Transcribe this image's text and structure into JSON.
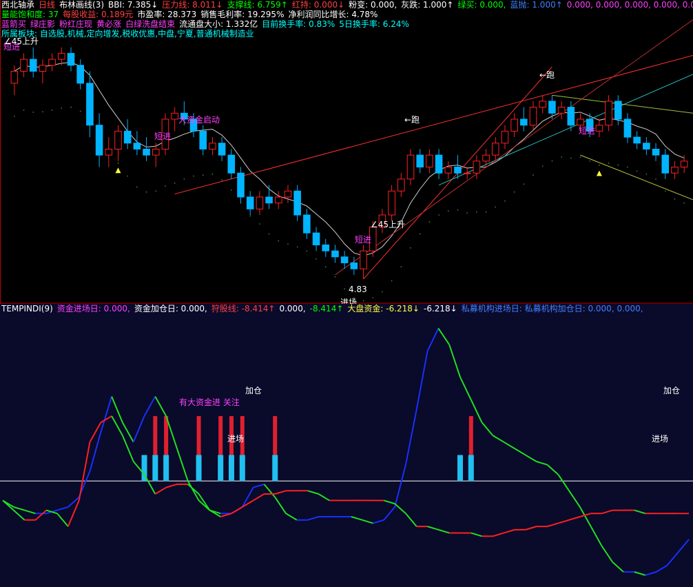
{
  "colors": {
    "up": "#ff2020",
    "down": "#00b4ff",
    "white": "#ffffff",
    "cyan": "#00ffff",
    "magenta": "#ff40ff",
    "yellow": "#ffff40",
    "green": "#00ff00",
    "blue": "#1830ff",
    "red": "#ff2020"
  },
  "header": {
    "line1": [
      {
        "t": "西北轴承",
        "c": "#ffffff"
      },
      {
        "t": "日线",
        "c": "#ff4040"
      },
      {
        "t": "布林画线(3)",
        "c": "#ffffff"
      },
      {
        "t": "BBI: 7.385↓",
        "c": "#ffffff"
      },
      {
        "t": "压力线: 8.011↓",
        "c": "#ff4040"
      },
      {
        "t": "支撑线: 6.759↑",
        "c": "#00ff00"
      },
      {
        "t": "红持: 0.000↓",
        "c": "#ff4040"
      },
      {
        "t": "粉变: 0.000,",
        "c": "#ffffff"
      },
      {
        "t": "灰跌: 1.000↑",
        "c": "#ffffff"
      },
      {
        "t": "绿买: 0.000,",
        "c": "#00ff00"
      },
      {
        "t": "蓝抛: 1.000↑",
        "c": "#4080ff"
      },
      {
        "t": "0.000, 0.000, 0.000, 0.000, 0.000,",
        "c": "#ff40ff"
      }
    ],
    "line2": [
      {
        "t": "量能饱和度: 37",
        "c": "#00ff00"
      },
      {
        "t": "每股收益: 0.189元",
        "c": "#ff4040"
      },
      {
        "t": "市盈率: 28.373",
        "c": "#ffffff"
      },
      {
        "t": "销售毛利率: 19.295%",
        "c": "#ffffff"
      },
      {
        "t": "净利润同比增长: 4.78%",
        "c": "#ffffff"
      }
    ],
    "line3": [
      {
        "t": "蓝箭买",
        "c": "#ff40ff"
      },
      {
        "t": "绿庄影",
        "c": "#ff40ff"
      },
      {
        "t": "粉红庄现",
        "c": "#ff40ff"
      },
      {
        "t": "黄必涨",
        "c": "#ff40ff"
      },
      {
        "t": "白绿洗盘结束",
        "c": "#ff40ff"
      },
      {
        "t": "流通盘大小: 1.332亿",
        "c": "#ffffff"
      },
      {
        "t": "目前换手率: 0.83%",
        "c": "#00ffff"
      },
      {
        "t": "5日换手率: 6.24%",
        "c": "#00ffff"
      }
    ],
    "line4": [
      {
        "t": "所属板块: 自选股,机械,定向增发,税收优惠,中盘,宁夏,普通机械制造业",
        "c": "#00ffff"
      }
    ]
  },
  "top_labels": [
    {
      "t": "短进",
      "c": "#ff40ff"
    },
    {
      "t": "∠45上升",
      "c": "#ffffff"
    },
    {
      "t": "大资金启动",
      "c": "#ff40ff"
    },
    {
      "t": "短进",
      "c": "#ff40ff"
    },
    {
      "t": "←跑",
      "c": "#ffffff"
    },
    {
      "t": "∠45上升",
      "c": "#ffffff"
    },
    {
      "t": "短进",
      "c": "#ff40ff"
    },
    {
      "t": "4.83",
      "c": "#ffffff"
    },
    {
      "t": "进场",
      "c": "#ffffff"
    },
    {
      "t": "←跑",
      "c": "#ffffff"
    },
    {
      "t": "短进",
      "c": "#ff40ff"
    }
  ],
  "indicator_header": [
    {
      "t": "TEMPINDI(9)",
      "c": "#ffffff"
    },
    {
      "t": "资金进场日: 0.000,",
      "c": "#ff40ff"
    },
    {
      "t": "资金加仓日: 0.000,",
      "c": "#ffffff"
    },
    {
      "t": "狩股线: -8.414↑",
      "c": "#ff4040"
    },
    {
      "t": "0.000,",
      "c": "#ffffff"
    },
    {
      "t": "-8.414↑",
      "c": "#00ff00"
    },
    {
      "t": "大盘资金: -6.218↓",
      "c": "#ffff40"
    },
    {
      "t": "-6.218↓",
      "c": "#ffffff"
    },
    {
      "t": "私募机构进场日: 私募机构加仓日: 0.000, 0.000,",
      "c": "#4080ff"
    }
  ],
  "bottom_labels": [
    {
      "t": "有大资金进 关注",
      "c": "#ff40ff"
    },
    {
      "t": "加仓",
      "c": "#ffffff"
    },
    {
      "t": "进场",
      "c": "#ffffff"
    },
    {
      "t": "加仓",
      "c": "#ffffff"
    },
    {
      "t": "进场",
      "c": "#ffffff"
    }
  ],
  "chart_data": [
    {
      "type": "candlestick",
      "title": "西北轴承 日线",
      "low_marker": 4.83,
      "candles": [
        [
          8.1,
          8.4,
          7.9,
          8.3
        ],
        [
          8.3,
          8.6,
          8.2,
          8.5
        ],
        [
          8.5,
          8.7,
          8.2,
          8.3
        ],
        [
          8.3,
          8.5,
          8.1,
          8.4
        ],
        [
          8.4,
          8.6,
          8.3,
          8.5
        ],
        [
          8.5,
          8.7,
          8.4,
          8.6
        ],
        [
          8.6,
          8.7,
          8.3,
          8.4
        ],
        [
          8.4,
          8.5,
          8.0,
          8.1
        ],
        [
          8.1,
          8.3,
          7.2,
          7.4
        ],
        [
          7.4,
          7.6,
          6.7,
          6.9
        ],
        [
          6.9,
          7.2,
          6.7,
          7.0
        ],
        [
          7.0,
          7.4,
          6.8,
          7.3
        ],
        [
          7.3,
          7.5,
          7.0,
          7.1
        ],
        [
          7.1,
          7.3,
          6.9,
          7.0
        ],
        [
          7.0,
          7.2,
          6.8,
          6.9
        ],
        [
          6.9,
          7.1,
          6.7,
          7.0
        ],
        [
          7.0,
          7.6,
          6.9,
          7.5
        ],
        [
          7.5,
          7.7,
          7.3,
          7.6
        ],
        [
          7.6,
          7.8,
          7.4,
          7.5
        ],
        [
          7.5,
          7.6,
          7.2,
          7.3
        ],
        [
          7.3,
          7.4,
          6.9,
          7.0
        ],
        [
          7.0,
          7.2,
          6.9,
          7.1
        ],
        [
          7.1,
          7.2,
          6.8,
          6.9
        ],
        [
          6.9,
          7.0,
          6.5,
          6.6
        ],
        [
          6.6,
          6.7,
          6.1,
          6.2
        ],
        [
          6.2,
          6.3,
          5.9,
          6.0
        ],
        [
          6.0,
          6.3,
          5.9,
          6.2
        ],
        [
          6.2,
          6.4,
          6.0,
          6.1
        ],
        [
          6.1,
          6.3,
          6.0,
          6.2
        ],
        [
          6.2,
          6.4,
          6.1,
          6.3
        ],
        [
          6.3,
          6.4,
          5.8,
          5.9
        ],
        [
          5.9,
          6.0,
          5.5,
          5.6
        ],
        [
          5.6,
          5.7,
          5.3,
          5.4
        ],
        [
          5.4,
          5.5,
          5.2,
          5.3
        ],
        [
          5.3,
          5.4,
          5.1,
          5.2
        ],
        [
          5.2,
          5.3,
          5.0,
          5.1
        ],
        [
          5.1,
          5.2,
          4.9,
          5.0
        ],
        [
          5.0,
          5.4,
          4.83,
          5.3
        ],
        [
          5.3,
          5.8,
          5.2,
          5.7
        ],
        [
          5.7,
          6.0,
          5.6,
          5.9
        ],
        [
          5.9,
          6.4,
          5.8,
          6.3
        ],
        [
          6.3,
          6.6,
          6.2,
          6.5
        ],
        [
          6.5,
          7.0,
          6.4,
          6.9
        ],
        [
          6.9,
          7.0,
          6.6,
          6.7
        ],
        [
          6.7,
          7.0,
          6.6,
          6.9
        ],
        [
          6.9,
          7.0,
          6.5,
          6.6
        ],
        [
          6.6,
          6.8,
          6.5,
          6.7
        ],
        [
          6.7,
          6.9,
          6.5,
          6.6
        ],
        [
          6.6,
          6.7,
          6.5,
          6.6
        ],
        [
          6.6,
          6.9,
          6.5,
          6.8
        ],
        [
          6.8,
          7.0,
          6.7,
          6.9
        ],
        [
          6.9,
          7.2,
          6.8,
          7.1
        ],
        [
          7.1,
          7.4,
          7.0,
          7.3
        ],
        [
          7.3,
          7.6,
          7.2,
          7.5
        ],
        [
          7.5,
          7.7,
          7.3,
          7.4
        ],
        [
          7.4,
          7.8,
          7.3,
          7.7
        ],
        [
          7.7,
          7.9,
          7.6,
          7.8
        ],
        [
          7.8,
          7.9,
          7.5,
          7.6
        ],
        [
          7.6,
          7.8,
          7.5,
          7.7
        ],
        [
          7.7,
          7.8,
          7.3,
          7.4
        ],
        [
          7.4,
          7.6,
          7.3,
          7.5
        ],
        [
          7.5,
          7.6,
          7.2,
          7.3
        ],
        [
          7.3,
          7.5,
          7.2,
          7.4
        ],
        [
          7.4,
          7.9,
          7.3,
          7.8
        ],
        [
          7.8,
          7.9,
          7.4,
          7.5
        ],
        [
          7.5,
          7.6,
          7.1,
          7.2
        ],
        [
          7.2,
          7.3,
          7.0,
          7.1
        ],
        [
          7.1,
          7.2,
          6.9,
          7.0
        ],
        [
          7.0,
          7.1,
          6.8,
          6.9
        ],
        [
          6.9,
          7.0,
          6.5,
          6.6
        ],
        [
          6.6,
          6.8,
          6.5,
          6.7
        ],
        [
          6.7,
          6.9,
          6.6,
          6.8
        ]
      ]
    },
    {
      "type": "line",
      "title": "TEMPINDI(9)",
      "series": [
        {
          "name": "狩股线",
          "values": [
            -6,
            -8,
            -9,
            -10,
            -10,
            -9,
            -8,
            -5,
            3,
            15,
            26,
            18,
            12,
            20,
            26,
            20,
            10,
            0,
            -6,
            -9,
            -10,
            -10,
            -8,
            -2,
            -1,
            -5,
            -10,
            -12,
            -12,
            -11,
            -11,
            -11,
            -11,
            -12,
            -13,
            -12,
            -8,
            5,
            22,
            40,
            47,
            42,
            32,
            25,
            18,
            14,
            12,
            10,
            8,
            6,
            5,
            2,
            -3,
            -8,
            -14,
            -20,
            -25,
            -28,
            -28,
            -29,
            -28,
            -26,
            -22,
            -18
          ]
        },
        {
          "name": "大盘资金",
          "values": [
            -6,
            -9,
            -12,
            -12,
            -9,
            -10,
            -14,
            -6,
            12,
            18,
            20,
            14,
            6,
            2,
            -4,
            -2,
            -1,
            -1,
            -4,
            -9,
            -11,
            -10,
            -8,
            -6,
            -4,
            -4,
            -3,
            -3,
            -3,
            -4,
            -6,
            -6,
            -6,
            -6,
            -6,
            -6,
            -7,
            -10,
            -14,
            -14,
            -15,
            -16,
            -16,
            -16,
            -17,
            -17,
            -16,
            -15,
            -15,
            -14,
            -14,
            -13,
            -12,
            -11,
            -10,
            -10,
            -9,
            -9,
            -9,
            -10,
            -10,
            -10,
            -10,
            -10
          ]
        }
      ],
      "baseline": 0,
      "entry_bars": [
        13,
        14,
        15,
        18,
        20,
        21,
        22,
        25,
        42,
        43
      ],
      "add_bars": [
        14,
        15,
        18,
        20,
        21,
        22,
        25,
        43
      ]
    }
  ]
}
